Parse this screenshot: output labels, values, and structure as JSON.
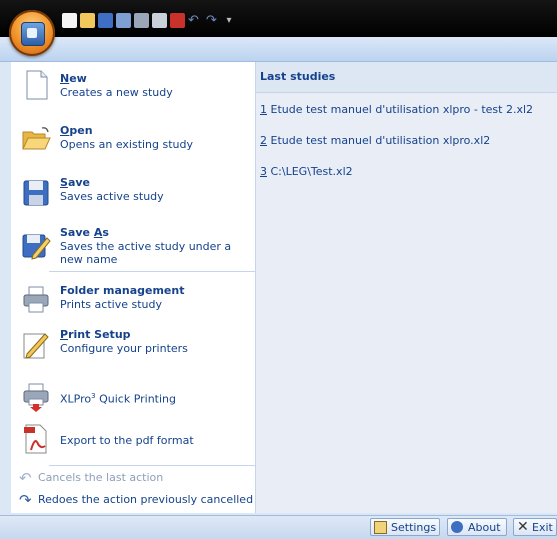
{
  "left_menu": {
    "new": {
      "title_u": "N",
      "title_rest": "ew",
      "desc": "Creates a new study"
    },
    "open": {
      "title_u": "O",
      "title_rest": "pen",
      "desc": "Opens an existing study"
    },
    "save": {
      "title_u": "S",
      "title_rest": "ave",
      "desc": "Saves active study"
    },
    "saveas": {
      "title_pre": "Save ",
      "title_u": "A",
      "title_rest": "s",
      "desc": "Saves the active study under a new name"
    },
    "folder": {
      "title": "Folder management",
      "desc": "Prints active study"
    },
    "printsetup": {
      "title_u": "P",
      "title_rest": "rint Setup",
      "desc": "Configure your printers"
    },
    "quickprint": {
      "label_pre": "XLPro",
      "label_sup": "3",
      "label_post": " Quick Printing"
    },
    "pdf": {
      "label": "Export to the pdf  format"
    },
    "undo": {
      "label": "Cancels the last action"
    },
    "redo": {
      "label": "Redoes the action previously cancelled"
    }
  },
  "recent": {
    "header": "Last studies",
    "items": [
      {
        "num": "1",
        "name": " Etude test manuel d'utilisation xlpro - test 2.xl2"
      },
      {
        "num": "2",
        "name": " Etude test manuel d'utilisation xlpro.xl2"
      },
      {
        "num": "3",
        "name": " C:\\LEG\\Test.xl2"
      }
    ]
  },
  "bottom": {
    "settings": "Settings",
    "about": "About",
    "exit": "Exit"
  },
  "qat_icons": [
    "new-doc-icon",
    "open-folder-icon",
    "save-icon",
    "save-as-icon",
    "print-icon",
    "folder-print-icon",
    "pdf-icon",
    "undo-icon",
    "redo-icon"
  ]
}
